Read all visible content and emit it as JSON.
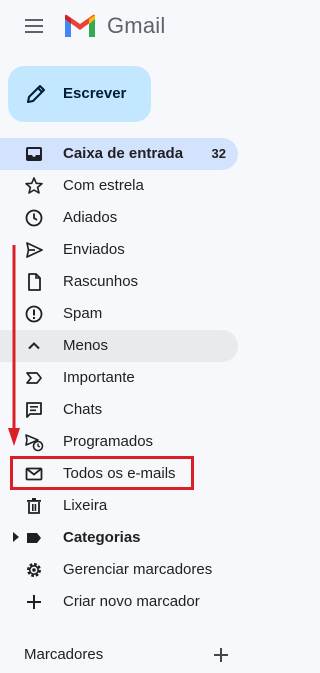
{
  "header": {
    "app_name": "Gmail"
  },
  "compose": {
    "label": "Escrever"
  },
  "nav": {
    "items": [
      {
        "label": "Caixa de entrada",
        "count": "32"
      },
      {
        "label": "Com estrela"
      },
      {
        "label": "Adiados"
      },
      {
        "label": "Enviados"
      },
      {
        "label": "Rascunhos"
      },
      {
        "label": "Spam"
      },
      {
        "label": "Menos"
      },
      {
        "label": "Importante"
      },
      {
        "label": "Chats"
      },
      {
        "label": "Programados"
      },
      {
        "label": "Todos os e-mails"
      },
      {
        "label": "Lixeira"
      },
      {
        "label": "Categorias"
      },
      {
        "label": "Gerenciar marcadores"
      },
      {
        "label": "Criar novo marcador"
      }
    ]
  },
  "labels_section": {
    "title": "Marcadores"
  },
  "colors": {
    "highlight": "#d92027",
    "active_bg": "#d3e3fd",
    "compose_bg": "#c2e7ff"
  }
}
